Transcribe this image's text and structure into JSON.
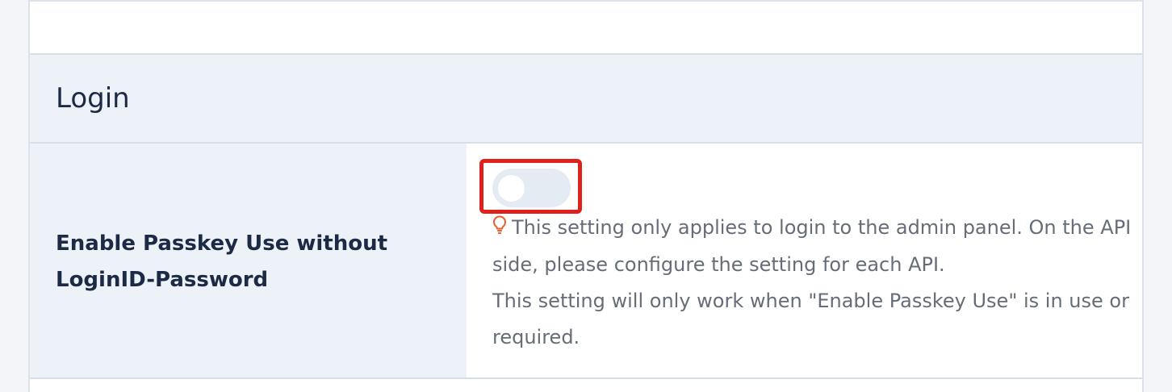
{
  "section": {
    "title": "Login"
  },
  "setting": {
    "label": "Enable Passkey Use without LoginID-Password",
    "toggle": {
      "state": "off"
    },
    "help": {
      "icon": "lightbulb-icon",
      "line1": "This setting only applies to login to the admin panel. On the API side, please configure the setting for each API.",
      "line2": "This setting will only work when \"Enable Passkey Use\" is in use or required."
    },
    "highlight_color": "#e0201b",
    "icon_color": "#e85d2c"
  }
}
